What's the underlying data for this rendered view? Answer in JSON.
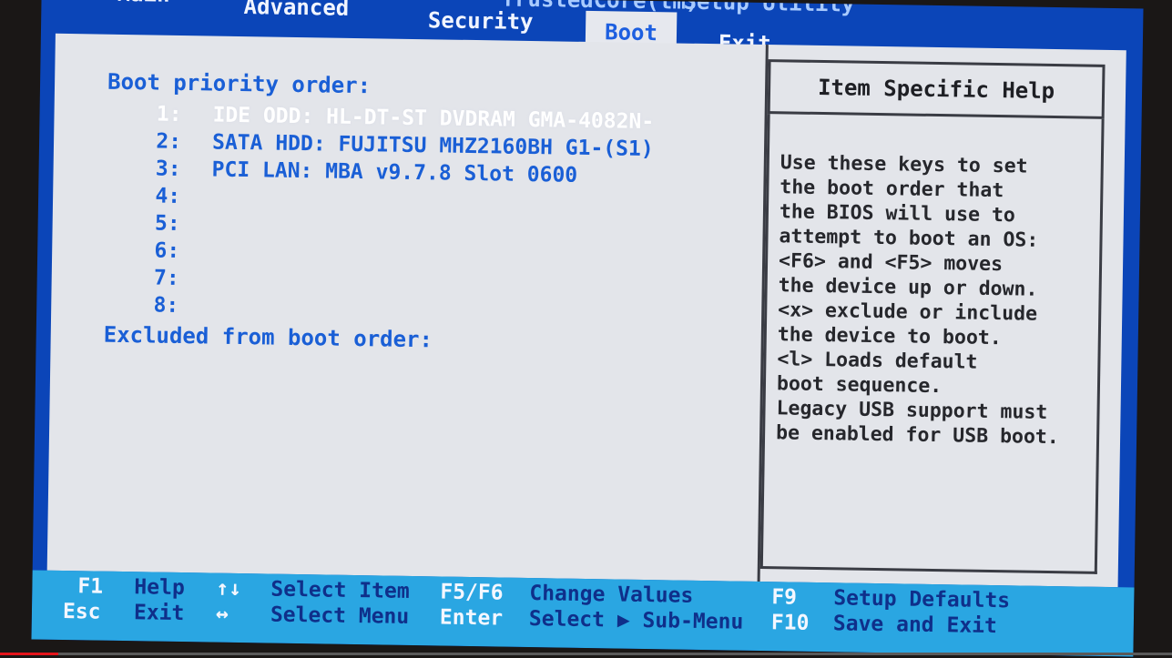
{
  "title": {
    "partial_left": "TrustedCore(tm)",
    "setup_label": "Setup Utility"
  },
  "tabs": [
    {
      "label": "Main"
    },
    {
      "label": "Advanced"
    },
    {
      "label": "Security"
    },
    {
      "label": "Boot",
      "active": true
    },
    {
      "label": "Exit"
    }
  ],
  "boot": {
    "priority_heading": "Boot priority order:",
    "items": [
      {
        "num": "1:",
        "device": "IDE ODD: HL-DT-ST DVDRAM GMA-4082N-",
        "selected": true
      },
      {
        "num": "2:",
        "device": "SATA HDD: FUJITSU MHZ2160BH G1-(S1)"
      },
      {
        "num": "3:",
        "device": "PCI LAN: MBA v9.7.8  Slot 0600"
      },
      {
        "num": "4:",
        "device": ""
      },
      {
        "num": "5:",
        "device": ""
      },
      {
        "num": "6:",
        "device": ""
      },
      {
        "num": "7:",
        "device": ""
      },
      {
        "num": "8:",
        "device": ""
      }
    ],
    "excluded_heading": "Excluded from boot order:"
  },
  "help": {
    "title": "Item Specific Help",
    "lines": [
      "Use these keys to set",
      "the boot order that",
      "the BIOS will use to",
      "attempt to boot an OS:",
      "<F6> and <F5> moves",
      "the device up or down.",
      "<x> exclude or include",
      "the device to boot.",
      "<l> Loads default",
      "boot sequence.",
      "Legacy USB support must",
      "be enabled for USB boot."
    ]
  },
  "keybar": {
    "f1": "F1",
    "help": "Help",
    "esc": "Esc",
    "exit": "Exit",
    "updown": "↑↓",
    "select_item": "Select Item",
    "leftright": "↔",
    "select_menu": "Select Menu",
    "f5f6": "F5/F6",
    "change_values": "Change Values",
    "enter": "Enter",
    "select_submenu": "Select ▶ Sub-Menu",
    "f9": "F9",
    "setup_defaults": "Setup Defaults",
    "f10": "F10",
    "save_exit": "Save and Exit"
  },
  "video_progress": 0.05
}
